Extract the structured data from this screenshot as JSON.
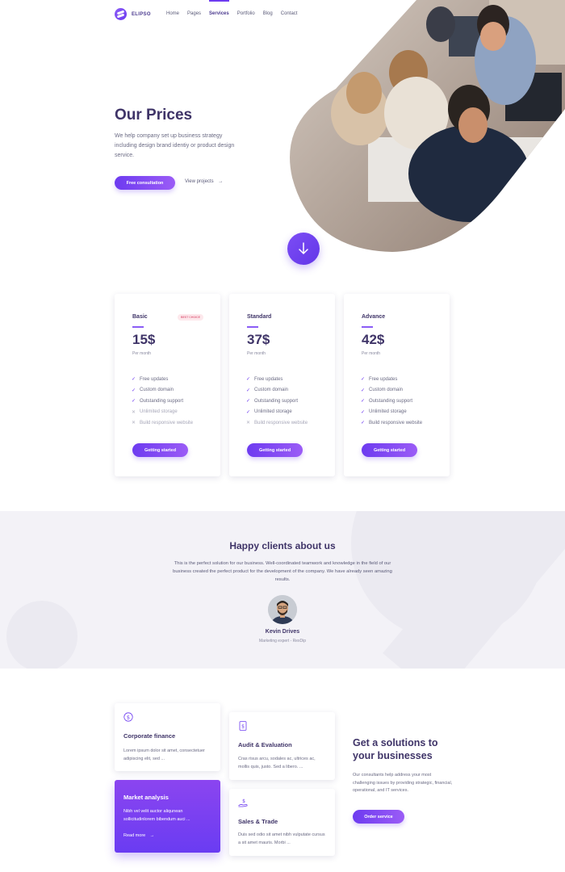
{
  "brand": {
    "name": "ELIPSO",
    "accent": "#6d3bf0"
  },
  "nav": {
    "items": [
      {
        "label": "Home"
      },
      {
        "label": "Pages"
      },
      {
        "label": "Services",
        "active": true
      },
      {
        "label": "Portfolio"
      },
      {
        "label": "Blog"
      },
      {
        "label": "Contact"
      }
    ]
  },
  "hero": {
    "title": "Our Prices",
    "description": "We help company set up business strategy including design brand identiy or product design service.",
    "primary_button": "Free consultation",
    "secondary_link": "View projects",
    "secondary_icon": "arrow-right-icon",
    "scroll_icon": "arrow-down-icon"
  },
  "pricing": {
    "plans": [
      {
        "name": "Basic",
        "badge": "BEST CHOICE",
        "price": "15$",
        "period": "Per month",
        "features": [
          {
            "label": "Free updates",
            "included": true
          },
          {
            "label": "Custom domain",
            "included": true
          },
          {
            "label": "Outstanding support",
            "included": true
          },
          {
            "label": "Unlimited storage",
            "included": false
          },
          {
            "label": "Build responsive website",
            "included": false
          }
        ],
        "button": "Getting started"
      },
      {
        "name": "Standard",
        "badge": "",
        "price": "37$",
        "period": "Per month",
        "features": [
          {
            "label": "Free updates",
            "included": true
          },
          {
            "label": "Custom domain",
            "included": true
          },
          {
            "label": "Outstanding support",
            "included": true
          },
          {
            "label": "Unlimited storage",
            "included": true
          },
          {
            "label": "Build responsive website",
            "included": false
          }
        ],
        "button": "Getting started"
      },
      {
        "name": "Advance",
        "badge": "",
        "price": "42$",
        "period": "Per month",
        "features": [
          {
            "label": "Free updates",
            "included": true
          },
          {
            "label": "Custom domain",
            "included": true
          },
          {
            "label": "Outstanding support",
            "included": true
          },
          {
            "label": "Unlimited storage",
            "included": true
          },
          {
            "label": "Build responsive website",
            "included": true
          }
        ],
        "button": "Getting started"
      }
    ]
  },
  "testimonial": {
    "title": "Happy clients about us",
    "text": "This is the perfect solution for our business. Well-coordinated teamwork and knowledge in the field of our business created the perfect product for the development of the company. We have already seen amazing results.",
    "name": "Kevin Drives",
    "role": "Marketing expert - RexDip"
  },
  "services": {
    "cards": [
      {
        "icon": "dollar-icon",
        "title": "Corporate finance",
        "text": "Lorem ipsum dolor sit amet, consectetuer adipiscing elit, sed ..."
      },
      {
        "icon": "chart-icon",
        "title": "Market analysis",
        "text": "Nibh vel velit auctor aliqunean sollicitudinlorem bibendum auci ...",
        "link": "Read more"
      },
      {
        "icon": "document-dollar-icon",
        "title": "Audit & Evaluation",
        "text": "Cras risus arcu, sodales ac, ultrices ac, mollis quis, justo. Sed a libero. ..."
      },
      {
        "icon": "hand-money-icon",
        "title": "Sales & Trade",
        "text": "Duis sed odio sit amet nibh vulputate cursus a sit amet mauris. Morbi ..."
      }
    ],
    "solutions": {
      "title": "Get a solutions to your businesses",
      "text": "Our consultants help address your most challenging issues by providing strategic, financial, operational, and IT services.",
      "button": "Order service"
    }
  }
}
